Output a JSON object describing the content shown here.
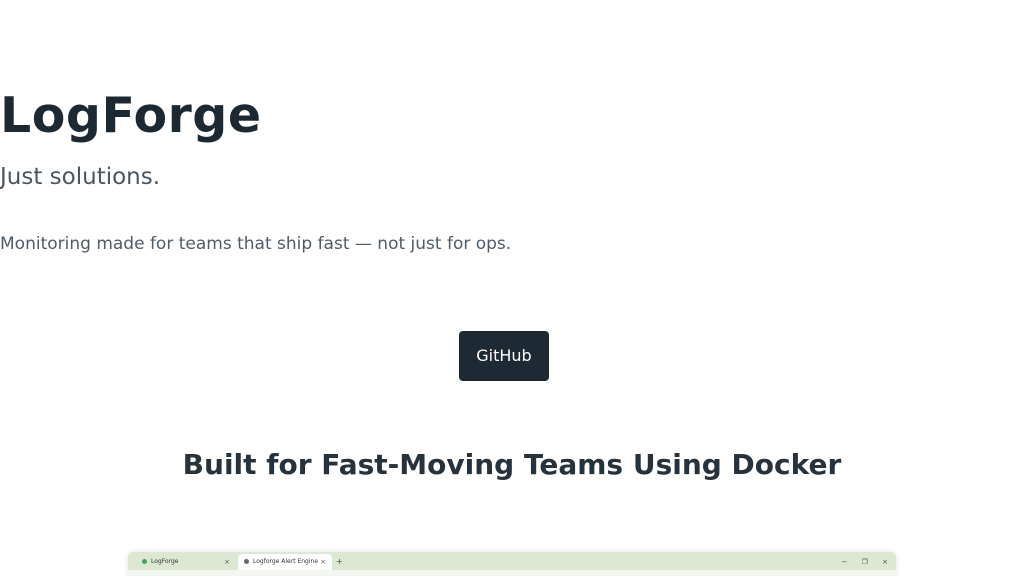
{
  "hero": {
    "title": "LogForge",
    "tagline": "Just solutions.",
    "description": "Monitoring made for teams that ship fast — not just for ops.",
    "github_label": "GitHub"
  },
  "section": {
    "title": "Built for Fast-Moving Teams Using Docker"
  },
  "preview": {
    "tabs": [
      {
        "label": "LogForge",
        "favicon": "green-dot-icon"
      },
      {
        "label": "Logforge Alert Engine",
        "favicon": "globe-icon"
      }
    ],
    "new_tab": "+",
    "window_controls": [
      "−",
      "❐",
      "×"
    ]
  },
  "colors": {
    "primary_dark": "#1e2a33",
    "text_dark": "#1c2832",
    "text_muted": "#4a5661",
    "browser_chrome": "#dce8d2"
  }
}
